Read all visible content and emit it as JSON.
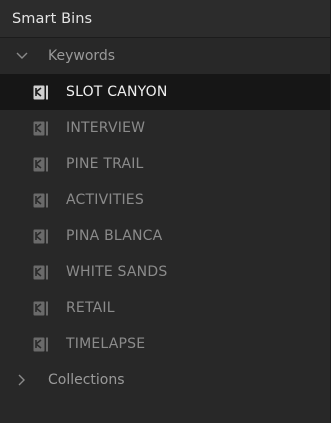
{
  "panel": {
    "title": "Smart Bins"
  },
  "keywords": {
    "label": "Keywords",
    "expanded": true,
    "icon": "chevron-down-icon",
    "items": [
      {
        "label": "SLOT CANYON",
        "selected": true,
        "icon": "smart-bin-icon"
      },
      {
        "label": "INTERVIEW",
        "selected": false,
        "icon": "smart-bin-icon"
      },
      {
        "label": "PINE TRAIL",
        "selected": false,
        "icon": "smart-bin-icon"
      },
      {
        "label": "ACTIVITIES",
        "selected": false,
        "icon": "smart-bin-icon"
      },
      {
        "label": "PINA BLANCA",
        "selected": false,
        "icon": "smart-bin-icon"
      },
      {
        "label": "WHITE SANDS",
        "selected": false,
        "icon": "smart-bin-icon"
      },
      {
        "label": "RETAIL",
        "selected": false,
        "icon": "smart-bin-icon"
      },
      {
        "label": "TIMELAPSE",
        "selected": false,
        "icon": "smart-bin-icon"
      }
    ]
  },
  "collections": {
    "label": "Collections",
    "expanded": false,
    "icon": "chevron-right-icon"
  },
  "colors": {
    "background": "#282828",
    "selected_row": "#161616",
    "selected_text": "#f0f0f0",
    "item_text": "#8b8b8b",
    "group_text": "#9a9a9a"
  }
}
